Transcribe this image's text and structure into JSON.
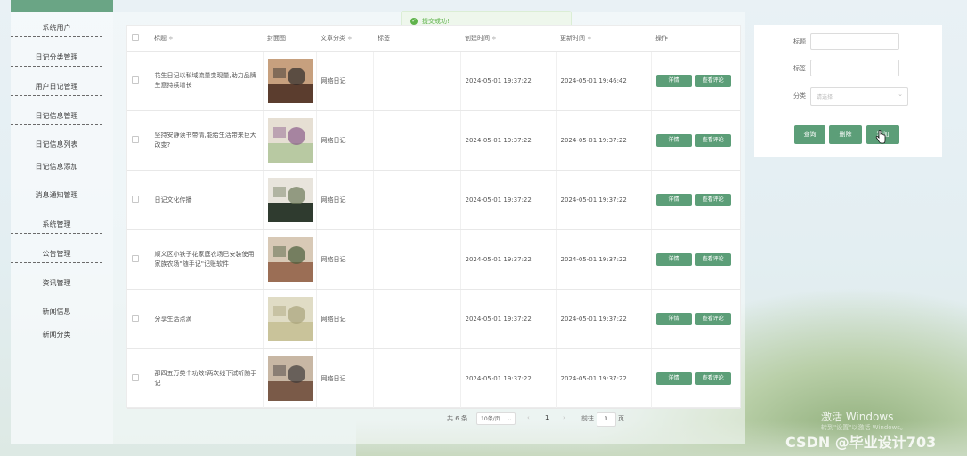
{
  "sidebar": {
    "items": [
      {
        "label": "系统用户",
        "group": true
      },
      {
        "label": "日记分类管理",
        "group": true
      },
      {
        "label": "用户日记管理",
        "group": true
      },
      {
        "label": "日记信息管理",
        "group": true
      },
      {
        "label": "日记信息列表",
        "group": false
      },
      {
        "label": "日记信息添加",
        "group": false
      },
      {
        "label": "消息通知管理",
        "group": true
      },
      {
        "label": "系统管理",
        "group": true
      },
      {
        "label": "公告管理",
        "group": true
      },
      {
        "label": "资讯管理",
        "group": true
      },
      {
        "label": "新闻信息",
        "group": false
      },
      {
        "label": "新闻分类",
        "group": false
      }
    ]
  },
  "toast": {
    "text": "提交成功!",
    "icon": "check-icon"
  },
  "table": {
    "headers": {
      "title": "标题",
      "cover": "封面图",
      "category": "文章分类",
      "tags": "标签",
      "created": "创建时间",
      "updated": "更新时间",
      "actions": "操作"
    },
    "sort_glyph": "≑",
    "rows": [
      {
        "title": "花生日记以私域流量变现量,助力品牌生意持续增长",
        "category": "网络日记",
        "tags": "",
        "created": "2024-05-01 19:37:22",
        "updated": "2024-05-01 19:46:42",
        "detail": "详情",
        "comment": "查看评论",
        "thumb_colors": [
          "#5b3d2e",
          "#c7a07e",
          "#2d2a2a"
        ]
      },
      {
        "title": "坚持安静读书带情,能给生活带来巨大改变?",
        "category": "网络日记",
        "tags": "",
        "created": "2024-05-01 19:37:22",
        "updated": "2024-05-01 19:37:22",
        "detail": "详情",
        "comment": "查看评论",
        "thumb_colors": [
          "#b8c9a2",
          "#e6dfd3",
          "#8a5c8a"
        ]
      },
      {
        "title": "日记文化传播",
        "category": "网络日记",
        "tags": "",
        "created": "2024-05-01 19:37:22",
        "updated": "2024-05-01 19:37:22",
        "detail": "详情",
        "comment": "查看评论",
        "thumb_colors": [
          "#2f3b2f",
          "#e8e4dc",
          "#6e7b5a"
        ]
      },
      {
        "title": "顺义区小铁子花家庭农场已安装使用家族农场\"随手记\"记账软件",
        "category": "网络日记",
        "tags": "",
        "created": "2024-05-01 19:37:22",
        "updated": "2024-05-01 19:37:22",
        "detail": "详情",
        "comment": "查看评论",
        "thumb_colors": [
          "#9b6e55",
          "#d8c9b6",
          "#4c5e3c"
        ]
      },
      {
        "title": "分享生活点滴",
        "category": "网络日记",
        "tags": "",
        "created": "2024-05-01 19:37:22",
        "updated": "2024-05-01 19:37:22",
        "detail": "详情",
        "comment": "查看评论",
        "thumb_colors": [
          "#c9c39a",
          "#e0dcc5",
          "#a8a27a"
        ]
      },
      {
        "title": "那四五万类个功效!两次线下试听随手记",
        "category": "网络日记",
        "tags": "",
        "created": "2024-05-01 19:37:22",
        "updated": "2024-05-01 19:37:22",
        "detail": "详情",
        "comment": "查看评论",
        "thumb_colors": [
          "#7a5a48",
          "#c8b7a4",
          "#3f3a3a"
        ]
      }
    ]
  },
  "pagination": {
    "total": "共 6 条",
    "page_size": "10条/页",
    "prev": "‹",
    "current_page": "1",
    "next": "›",
    "goto_label": "前往",
    "goto_value": "1",
    "page_unit": "页"
  },
  "search": {
    "title_label": "标题",
    "title_value": "",
    "tags_label": "标签",
    "tags_value": "",
    "category_label": "分类",
    "category_placeholder": "请选择",
    "query_button": "查询",
    "delete_button": "删除",
    "add_button": "添加"
  },
  "watermark": {
    "line1": "激活 Windows",
    "line2": "转到\"设置\"以激活 Windows。",
    "csdn": "CSDN @毕业设计703"
  },
  "colors": {
    "accent": "#5c9e78",
    "topbar": "#6aa585",
    "success": "#5fb34b"
  }
}
